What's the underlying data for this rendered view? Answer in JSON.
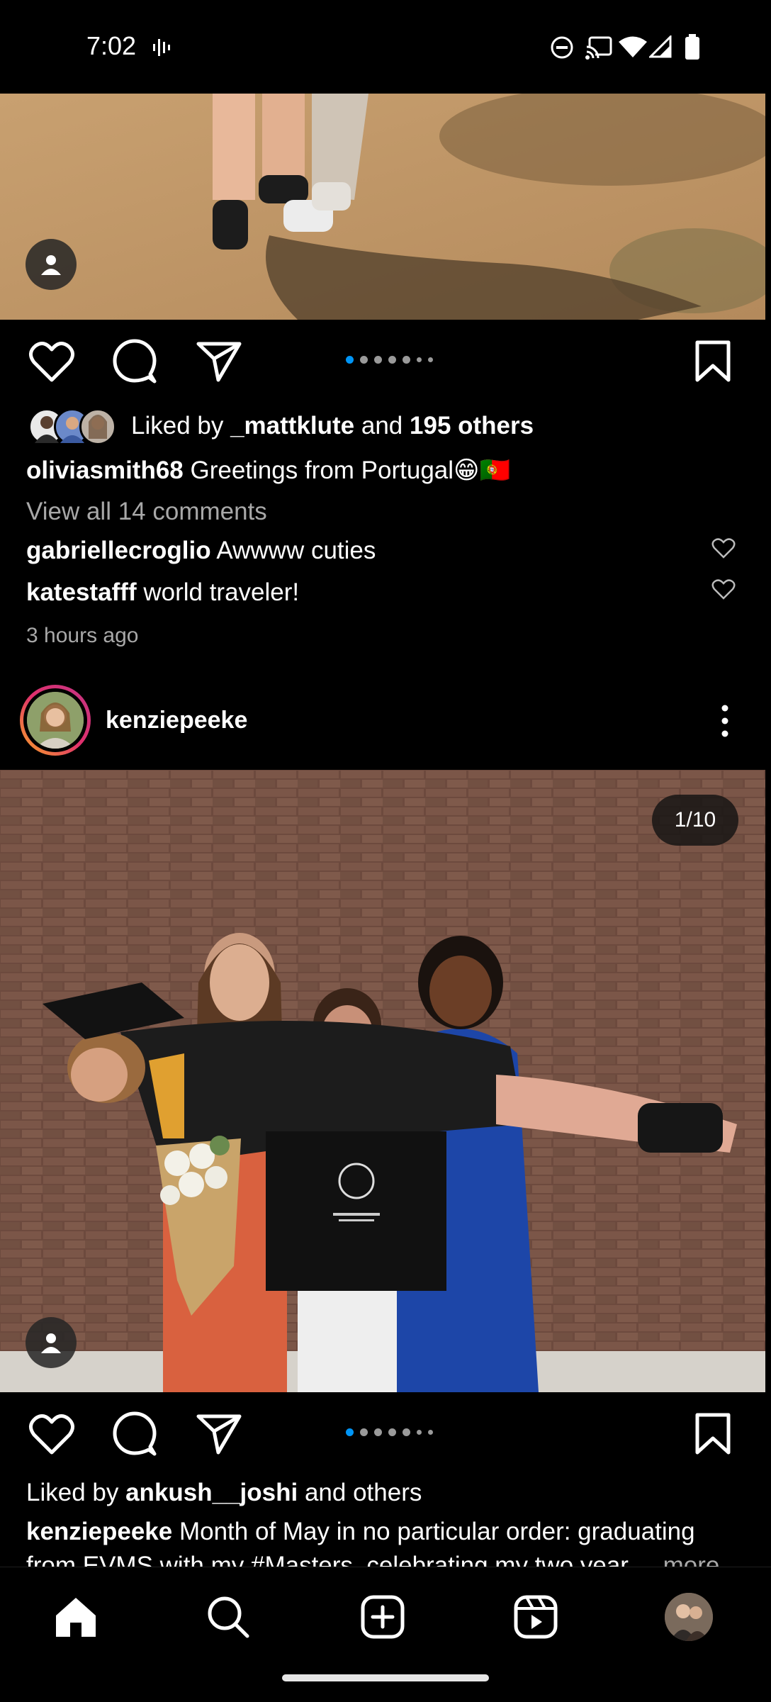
{
  "status_bar": {
    "time": "7:02"
  },
  "post1": {
    "liked_prefix": "Liked by ",
    "liked_user": "_mattklute",
    "liked_mid": " and ",
    "liked_count": "195 others",
    "caption_user": "oliviasmith68",
    "caption_text": " Greetings from Portugal😁🇵🇹",
    "view_comments": "View all 14 comments",
    "comments": [
      {
        "user": "gabriellecroglio",
        "text": " Awwww cuties"
      },
      {
        "user": "katestafff",
        "text": " world traveler!"
      }
    ],
    "time_ago": "3 hours ago",
    "carousel": {
      "count": 7,
      "active_index": 0
    }
  },
  "post2": {
    "username": "kenziepeeke",
    "counter": "1/10",
    "liked_prefix": "Liked by ",
    "liked_user": "ankush__joshi",
    "liked_suffix": " and others",
    "caption_user": "kenziepeeke",
    "caption_text": " Month of May in no particular order: graduating",
    "caption_line2": "from EVMS with my #Masters, celebrating my two year",
    "more": "... more",
    "carousel": {
      "count": 7,
      "active_index": 0
    }
  },
  "colors": {
    "accent": "#0095f6",
    "story_ring_start": "#f9a825",
    "story_ring_end": "#c13584"
  },
  "nav": [
    "home-icon",
    "search-icon",
    "create-icon",
    "reels-icon",
    "profile-avatar"
  ]
}
